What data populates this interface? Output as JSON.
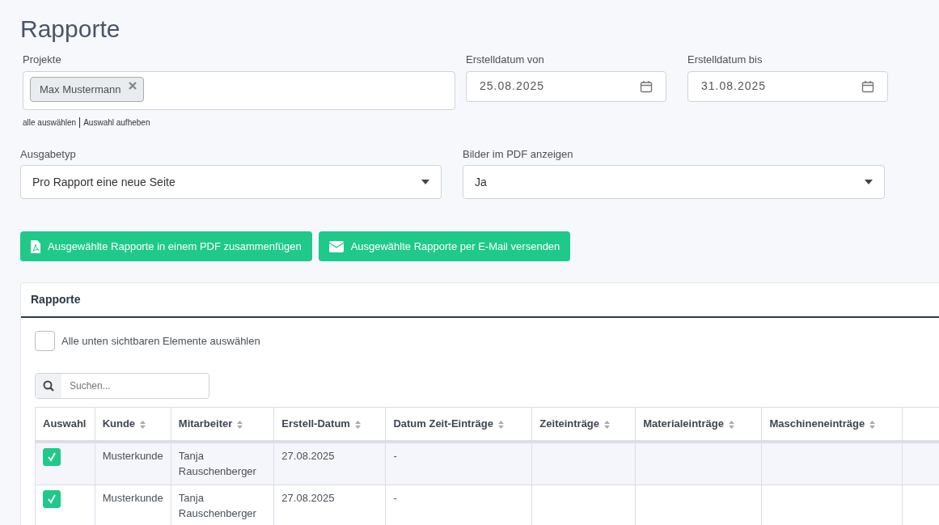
{
  "page_title": "Rapporte",
  "filters": {
    "projects": {
      "label": "Projekte",
      "tags": [
        {
          "label": "Max Mustermann"
        }
      ],
      "links": [
        "alle auswählen",
        "Auswahl aufheben"
      ]
    },
    "date_from": {
      "label": "Erstelldatum von",
      "value": "25.08.2025"
    },
    "date_to": {
      "label": "Erstelldatum bis",
      "value": "31.08.2025"
    },
    "output_type": {
      "label": "Ausgabetyp",
      "value": "Pro Rapport eine neue Seite"
    },
    "images_in_pdf": {
      "label": "Bilder im PDF anzeigen",
      "value": "Ja"
    }
  },
  "actions": [
    {
      "kind": "pdf",
      "label": "Ausgewählte Rapporte in einem PDF zusammenfügen"
    },
    {
      "kind": "mail",
      "label": "Ausgewählte Rapporte per E-Mail versenden"
    }
  ],
  "card": {
    "title": "Rapporte",
    "select_all": {
      "label": "Alle unten sichtbaren Elemente auswählen",
      "checked": false
    },
    "search": {
      "placeholder": "Suchen..."
    },
    "table": {
      "columns": [
        {
          "label": "Auswahl",
          "sortable": false
        },
        {
          "label": "Kunde",
          "sortable": true
        },
        {
          "label": "Mitarbeiter",
          "sortable": true
        },
        {
          "label": "Erstell-Datum",
          "sortable": true
        },
        {
          "label": "Datum Zeit-Einträge",
          "sortable": true
        },
        {
          "label": "Zeiteinträge",
          "sortable": true
        },
        {
          "label": "Materialeinträge",
          "sortable": true
        },
        {
          "label": "Maschineneinträge",
          "sortable": true
        }
      ],
      "rows": [
        {
          "cells": [
            {
              "kind": "checkbox",
              "checked": true
            },
            {
              "kind": "text",
              "text": "Musterkunde"
            },
            {
              "kind": "text",
              "text": "Tanja Rauschenberger"
            },
            {
              "kind": "text",
              "text": "27.08.2025"
            },
            {
              "kind": "text",
              "text": "-"
            }
          ]
        },
        {
          "cells": [
            {
              "kind": "checkbox",
              "checked": true
            },
            {
              "kind": "text",
              "text": "Musterkunde"
            },
            {
              "kind": "text",
              "text": "Tanja Rauschenberger"
            },
            {
              "kind": "text",
              "text": "27.08.2025"
            },
            {
              "kind": "text",
              "text": "-"
            }
          ]
        }
      ]
    }
  }
}
